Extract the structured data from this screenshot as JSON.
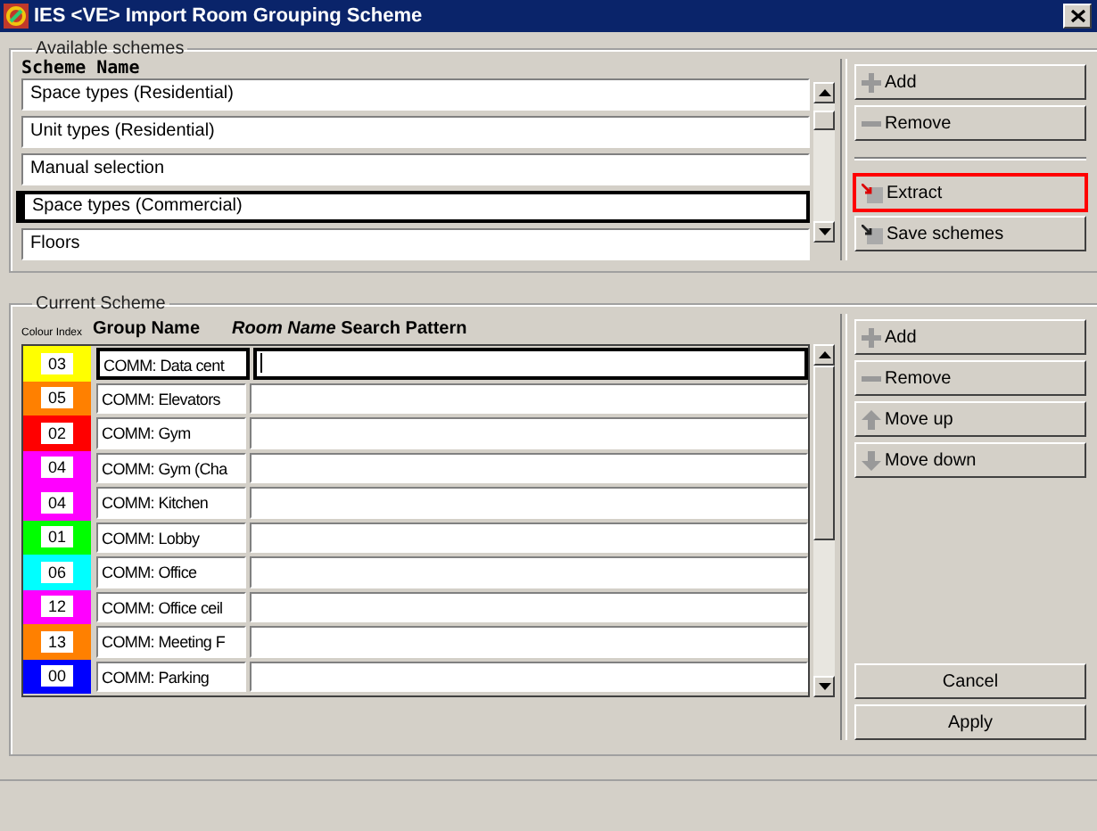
{
  "window": {
    "title": "IES <VE> Import Room Grouping Scheme"
  },
  "available_schemes": {
    "legend": "Available schemes",
    "column_heading": "Scheme Name",
    "items": [
      {
        "label": "Space types (Residential)",
        "selected": false
      },
      {
        "label": "Unit types (Residential)",
        "selected": false
      },
      {
        "label": "Manual selection",
        "selected": false
      },
      {
        "label": "Space types (Commercial)",
        "selected": true
      },
      {
        "label": "Floors",
        "selected": false
      }
    ],
    "buttons": [
      {
        "label": "Add",
        "kind": "add",
        "highlighted": false
      },
      {
        "label": "Remove",
        "kind": "remove",
        "highlighted": false
      },
      {
        "label": "Extract",
        "kind": "extract",
        "highlighted": true
      },
      {
        "label": "Save schemes",
        "kind": "save",
        "highlighted": false
      }
    ]
  },
  "current_scheme": {
    "legend": "Current Scheme",
    "headings": [
      "Colour Index",
      "Group Name",
      "*Room Name* Search Pattern"
    ],
    "rows": [
      {
        "index": "03",
        "color": "#ffff00",
        "group": "COMM: Data cent",
        "selected": true
      },
      {
        "index": "05",
        "color": "#ff8000",
        "group": "COMM: Elevators",
        "selected": false
      },
      {
        "index": "02",
        "color": "#ff0000",
        "group": "COMM: Gym",
        "selected": false
      },
      {
        "index": "04",
        "color": "#ff00ff",
        "group": "COMM: Gym (Cha",
        "selected": false
      },
      {
        "index": "04",
        "color": "#ff00ff",
        "group": "COMM: Kitchen",
        "selected": false
      },
      {
        "index": "01",
        "color": "#00ff00",
        "group": "COMM: Lobby",
        "selected": false
      },
      {
        "index": "06",
        "color": "#00ffff",
        "group": "COMM: Office",
        "selected": false
      },
      {
        "index": "12",
        "color": "#ff00ff",
        "group": "COMM: Office ceil",
        "selected": false
      },
      {
        "index": "13",
        "color": "#ff8000",
        "group": "COMM: Meeting F",
        "selected": false
      },
      {
        "index": "00",
        "color": "#0000ff",
        "group": "COMM: Parking",
        "selected": false
      }
    ],
    "buttons": [
      {
        "label": "Add",
        "kind": "add"
      },
      {
        "label": "Remove",
        "kind": "remove"
      },
      {
        "label": "Move up",
        "kind": "up"
      },
      {
        "label": "Move down",
        "kind": "down"
      }
    ],
    "footer_buttons": [
      "Cancel",
      "Apply"
    ]
  }
}
